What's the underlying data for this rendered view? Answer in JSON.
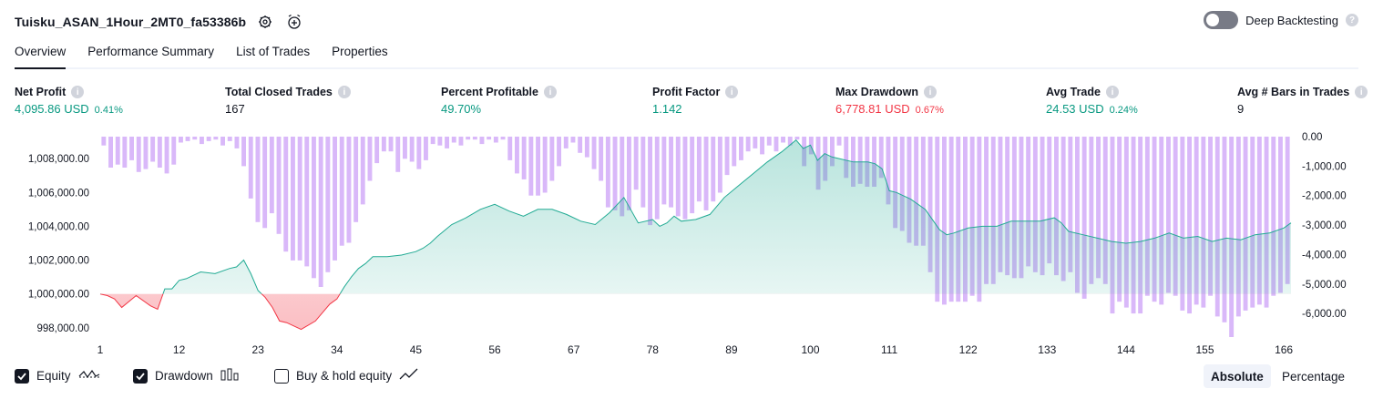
{
  "header": {
    "title": "Tuisku_ASAN_1Hour_2MT0_fa53386b",
    "deep_backtesting_label": "Deep Backtesting",
    "deep_backtesting_enabled": false
  },
  "tabs": [
    {
      "label": "Overview",
      "active": true
    },
    {
      "label": "Performance Summary",
      "active": false
    },
    {
      "label": "List of Trades",
      "active": false
    },
    {
      "label": "Properties",
      "active": false
    }
  ],
  "metrics": {
    "net_profit": {
      "label": "Net Profit",
      "value": "4,095.86 USD",
      "pct": "0.41%"
    },
    "total_closed_trades": {
      "label": "Total Closed Trades",
      "value": "167"
    },
    "percent_profitable": {
      "label": "Percent Profitable",
      "value": "49.70%"
    },
    "profit_factor": {
      "label": "Profit Factor",
      "value": "1.142"
    },
    "max_drawdown": {
      "label": "Max Drawdown",
      "value": "6,778.81 USD",
      "pct": "0.67%"
    },
    "avg_trade": {
      "label": "Avg Trade",
      "value": "24.53 USD",
      "pct": "0.24%"
    },
    "avg_bars": {
      "label": "Avg # Bars in Trades",
      "value": "9"
    }
  },
  "legend": {
    "equity": {
      "label": "Equity",
      "checked": true
    },
    "drawdown": {
      "label": "Drawdown",
      "checked": true
    },
    "buy_hold": {
      "label": "Buy & hold equity",
      "checked": false
    }
  },
  "modes": {
    "absolute": "Absolute",
    "percentage": "Percentage",
    "active": "absolute"
  },
  "colors": {
    "equity_up_line": "#22ab94",
    "equity_down_line": "#f23645",
    "drawdown_bar": "#d9b8f9",
    "positive_text": "#089981",
    "negative_text": "#f23645"
  },
  "chart_data": {
    "type": "area",
    "x_ticks": [
      "1",
      "12",
      "23",
      "34",
      "45",
      "56",
      "67",
      "78",
      "89",
      "100",
      "111",
      "122",
      "133",
      "144",
      "155",
      "166"
    ],
    "left_axis": {
      "ticks": [
        "1,008,000.00",
        "1,006,000.00",
        "1,004,000.00",
        "1,002,000.00",
        "1,000,000.00",
        "998,000.00"
      ],
      "tick_values": [
        1008000,
        1006000,
        1004000,
        1002000,
        1000000,
        998000
      ],
      "range": [
        997450,
        1009300
      ]
    },
    "right_axis": {
      "ticks": [
        "0.00",
        "-1,000.00",
        "-2,000.00",
        "-3,000.00",
        "-4,000.00",
        "-5,000.00",
        "-6,000.00"
      ],
      "tick_values": [
        0,
        -1000,
        -2000,
        -3000,
        -4000,
        -5000,
        -6000
      ],
      "range": [
        -6800,
        0
      ]
    },
    "series": [
      {
        "name": "Equity",
        "type": "line",
        "x": [
          1,
          2,
          3,
          4,
          6,
          8,
          9,
          10,
          11,
          12,
          13,
          14,
          15,
          17,
          19,
          20,
          21,
          22,
          23,
          24,
          25,
          26,
          27,
          29,
          31,
          32,
          33,
          34,
          35,
          36,
          37,
          38,
          39,
          41,
          43,
          45,
          46,
          47,
          48,
          50,
          52,
          54,
          56,
          58,
          60,
          62,
          64,
          66,
          68,
          70,
          72,
          74,
          76,
          78,
          79,
          80,
          81,
          82,
          84,
          86,
          88,
          90,
          92,
          94,
          96,
          98,
          99,
          100,
          101,
          102,
          103,
          104,
          106,
          108,
          109,
          110,
          111,
          112,
          114,
          116,
          118,
          119,
          120,
          122,
          124,
          126,
          128,
          130,
          132,
          134,
          135,
          136,
          138,
          140,
          142,
          144,
          146,
          148,
          150,
          152,
          154,
          156,
          158,
          160,
          162,
          164,
          166,
          167
        ],
        "values": [
          1000000,
          999900,
          999700,
          999200,
          999900,
          999300,
          999100,
          1000300,
          1000300,
          1000800,
          1000900,
          1001100,
          1001300,
          1001200,
          1001500,
          1001600,
          1002000,
          1001200,
          1000200,
          999800,
          999200,
          998400,
          998300,
          997900,
          998400,
          998900,
          999400,
          999700,
          1000400,
          1001000,
          1001500,
          1001800,
          1002200,
          1002200,
          1002300,
          1002500,
          1002700,
          1003000,
          1003400,
          1004100,
          1004500,
          1005000,
          1005300,
          1004900,
          1004600,
          1005000,
          1005000,
          1004700,
          1004300,
          1004100,
          1004800,
          1005700,
          1004200,
          1004400,
          1004000,
          1004200,
          1004600,
          1004300,
          1004400,
          1004700,
          1005700,
          1006400,
          1007100,
          1007800,
          1008400,
          1009100,
          1008600,
          1008800,
          1007900,
          1008300,
          1008100,
          1008000,
          1007800,
          1007800,
          1007700,
          1007400,
          1006100,
          1006000,
          1005600,
          1005000,
          1003800,
          1003500,
          1003600,
          1003900,
          1004000,
          1004000,
          1004300,
          1004300,
          1004300,
          1004500,
          1004200,
          1003700,
          1003500,
          1003300,
          1003100,
          1003000,
          1003100,
          1003300,
          1003600,
          1003300,
          1003400,
          1003100,
          1003300,
          1003200,
          1003500,
          1003600,
          1003900,
          1004200
        ]
      },
      {
        "name": "Drawdown",
        "type": "bar",
        "values": [
          -300,
          -1050,
          -950,
          -1050,
          -800,
          -1200,
          -1100,
          -850,
          -1050,
          -1250,
          -950,
          -200,
          -150,
          -100,
          -250,
          -150,
          -100,
          -300,
          -150,
          -400,
          -1000,
          -2100,
          -2900,
          -3100,
          -2600,
          -3300,
          -3900,
          -4200,
          -4200,
          -4400,
          -4800,
          -5100,
          -4600,
          -4200,
          -3700,
          -3600,
          -2900,
          -2300,
          -1500,
          -900,
          -500,
          -500,
          -1200,
          -750,
          -850,
          -1100,
          -800,
          -250,
          -300,
          -400,
          -200,
          -300,
          -100,
          -100,
          -250,
          -100,
          -200,
          -100,
          -800,
          -1250,
          -1450,
          -2000,
          -2000,
          -1900,
          -1500,
          -1000,
          -400,
          -200,
          -550,
          -700,
          -1100,
          -1500,
          -2400,
          -2500,
          -2700,
          -2500,
          -1800,
          -2400,
          -3000,
          -2800,
          -2300,
          -2400,
          -2700,
          -2800,
          -2600,
          -2200,
          -2500,
          -2200,
          -1900,
          -1300,
          -1000,
          -800,
          -500,
          -400,
          -600,
          -300,
          -500,
          -200,
          -300,
          -100,
          -1000,
          -600,
          -1800,
          -1500,
          -1000,
          -300,
          -1400,
          -1700,
          -1600,
          -1700,
          -1700,
          -1400,
          -2300,
          -3100,
          -3200,
          -3600,
          -3700,
          -3700,
          -4600,
          -5600,
          -5700,
          -5600,
          -5600,
          -5600,
          -5400,
          -5600,
          -5000,
          -5000,
          -4600,
          -4700,
          -4800,
          -4800,
          -4400,
          -4600,
          -4700,
          -4300,
          -4700,
          -4900,
          -4600,
          -5300,
          -5500,
          -5000,
          -4800,
          -5000,
          -6000,
          -5600,
          -5800,
          -6000,
          -6000,
          -5400,
          -5600,
          -5700,
          -5300,
          -5400,
          -5900,
          -6000,
          -5700,
          -5800,
          -5400,
          -6100,
          -6300,
          -6800,
          -6100,
          -5900,
          -5800,
          -5700,
          -5800,
          -5400,
          -5300,
          -5000
        ]
      }
    ]
  }
}
